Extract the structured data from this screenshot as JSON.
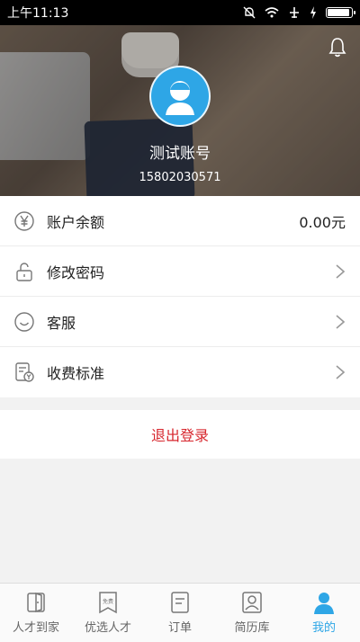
{
  "status_bar": {
    "time": "上午11:13"
  },
  "header": {
    "account_name": "测试账号",
    "account_phone": "15802030571"
  },
  "menu": [
    {
      "label": "账户余额",
      "value": "0.00元",
      "icon": "yen-icon"
    },
    {
      "label": "修改密码",
      "icon": "lock-icon"
    },
    {
      "label": "客服",
      "icon": "smile-icon"
    },
    {
      "label": "收费标准",
      "icon": "document-yen-icon"
    }
  ],
  "logout_label": "退出登录",
  "bottom_nav": [
    {
      "label": "人才到家",
      "icon": "door-icon",
      "active": false
    },
    {
      "label": "优选人才",
      "icon": "free-tag-icon",
      "active": false
    },
    {
      "label": "订单",
      "icon": "order-icon",
      "active": false
    },
    {
      "label": "简历库",
      "icon": "resume-icon",
      "active": false
    },
    {
      "label": "我的",
      "icon": "person-icon",
      "active": true
    }
  ],
  "colors": {
    "accent": "#2ea6e6",
    "logout": "#d7262d"
  }
}
